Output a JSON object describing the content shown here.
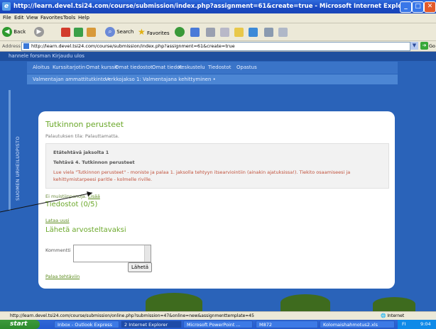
{
  "window": {
    "title": "http://learn.devel.tsi24.com/course/submission/index.php?assignment=61&create=true - Microsoft Internet Explorer"
  },
  "menu": [
    "File",
    "Edit",
    "View",
    "Favorites",
    "Tools",
    "Help"
  ],
  "toolbar": {
    "back": "Back",
    "search": "Search",
    "favorites": "Favorites"
  },
  "address": {
    "label": "Address",
    "url": "http://learn.devel.tsi24.com/course/submission/index.php?assignment=61&create=true",
    "go": "Go"
  },
  "page": {
    "user": "hannele forsman Kirjaudu ulos",
    "nav1": [
      "Aloitus",
      "Kurssitarjotin",
      "Omat kurssit",
      "Omat tiedostot",
      "Omat tiedot",
      "Keskustelu",
      "Tiedostot",
      "Opastus"
    ],
    "nav2": [
      "Valmentajan ammattitutkinto •",
      "Verkkojakso 1: Valmentajana kehittyminen •"
    ],
    "side_text": "SUOMEN URHEILUOPISTO",
    "title": "Tutkinnon perusteet",
    "status": "Palautuksen tila: Palauttamatta.",
    "task": {
      "label1": "Etätehtävä jaksolta 1",
      "label2": "Tehtävä 4. Tutkinnon perusteet",
      "text": "Lue viela \"Tutkinnon perusteet\" - moniste ja palaa 1. jaksolla tehtyyn itsearviointiin (ainakin ajatuksissa!). Tiekito osaamiseesi ja kehittymistarpeesi paritle - kolmelle riville."
    },
    "notes_text": "Ei muistiinpanoja.",
    "notes_link": "Lisää",
    "files_heading": "Tiedostot (0/5)",
    "send_file": "Lataa uusi",
    "submit_heading": "Lähetä arvosteltavaksi",
    "comment_label": "Kommentti",
    "send_button": "Lähetä",
    "back_link": "Palaa tehtäviin"
  },
  "statusbar": {
    "text": "http://learn.devel.tsi24.com/course/submission/online.php?submission=47&online=new&assignmenttemplate=45",
    "zone": "Internet"
  },
  "taskbar": {
    "start": "start",
    "tasks": [
      "Inbox - Outlook Express",
      "2 Internet Explorer",
      "Microsoft PowerPoint ...",
      "M872",
      "Kolomaishahmotus2.xls"
    ],
    "tray": [
      "FI",
      "9:04"
    ]
  },
  "colors": {
    "page_bg": "#2a63b9",
    "heading_green": "#6ba82a",
    "task_red": "#c0503a"
  }
}
